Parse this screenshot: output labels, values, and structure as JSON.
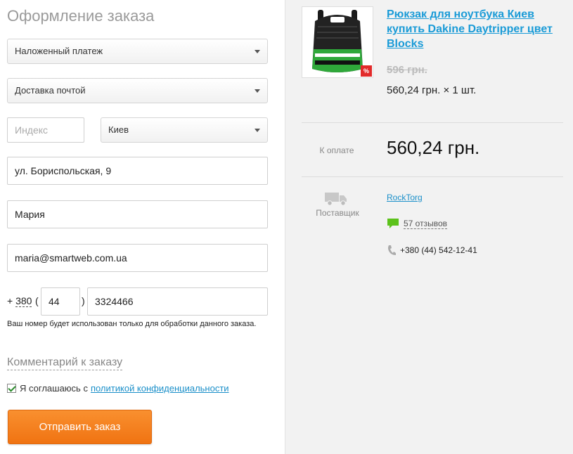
{
  "form": {
    "title": "Оформление заказа",
    "payment_select": "Наложенный платеж",
    "delivery_select": "Доставка почтой",
    "postcode_placeholder": "Индекс",
    "city_select": "Киев",
    "address_value": "ул. Бориспольская, 9",
    "name_value": "Мария",
    "email_value": "maria@smartweb.com.ua",
    "phone_plus": "+",
    "phone_country_code": "380",
    "phone_open_paren": "(",
    "phone_close_paren": ")",
    "phone_area_code": "44",
    "phone_number": "3324466",
    "phone_hint": "Ваш номер будет использован только для обработки данного заказа.",
    "comment_link": "Комментарий к заказу",
    "agree_text": "Я соглашаюсь с",
    "agree_link": "политикой конфиденциальности",
    "agree_checked": true,
    "submit_label": "Отправить заказ"
  },
  "order": {
    "product_title": "Рюкзак для ноутбука Киев купить Dakine Daytripper цвет Blocks",
    "sale_badge": "%",
    "old_price": "596 грн.",
    "price_qty": "560,24 грн. × 1 шт.",
    "pay_label": "К оплате",
    "pay_total": "560,24 грн.",
    "supplier_label": "Поставщик",
    "seller_name": "RockTorg",
    "reviews": "57 отзывов",
    "seller_phone": "+380 (44) 542-12-41"
  },
  "colors": {
    "accent_link": "#1a9bd7",
    "submit_button": "#f07312",
    "review_icon": "#5cc21b",
    "backpack_green": "#2fa83a"
  }
}
